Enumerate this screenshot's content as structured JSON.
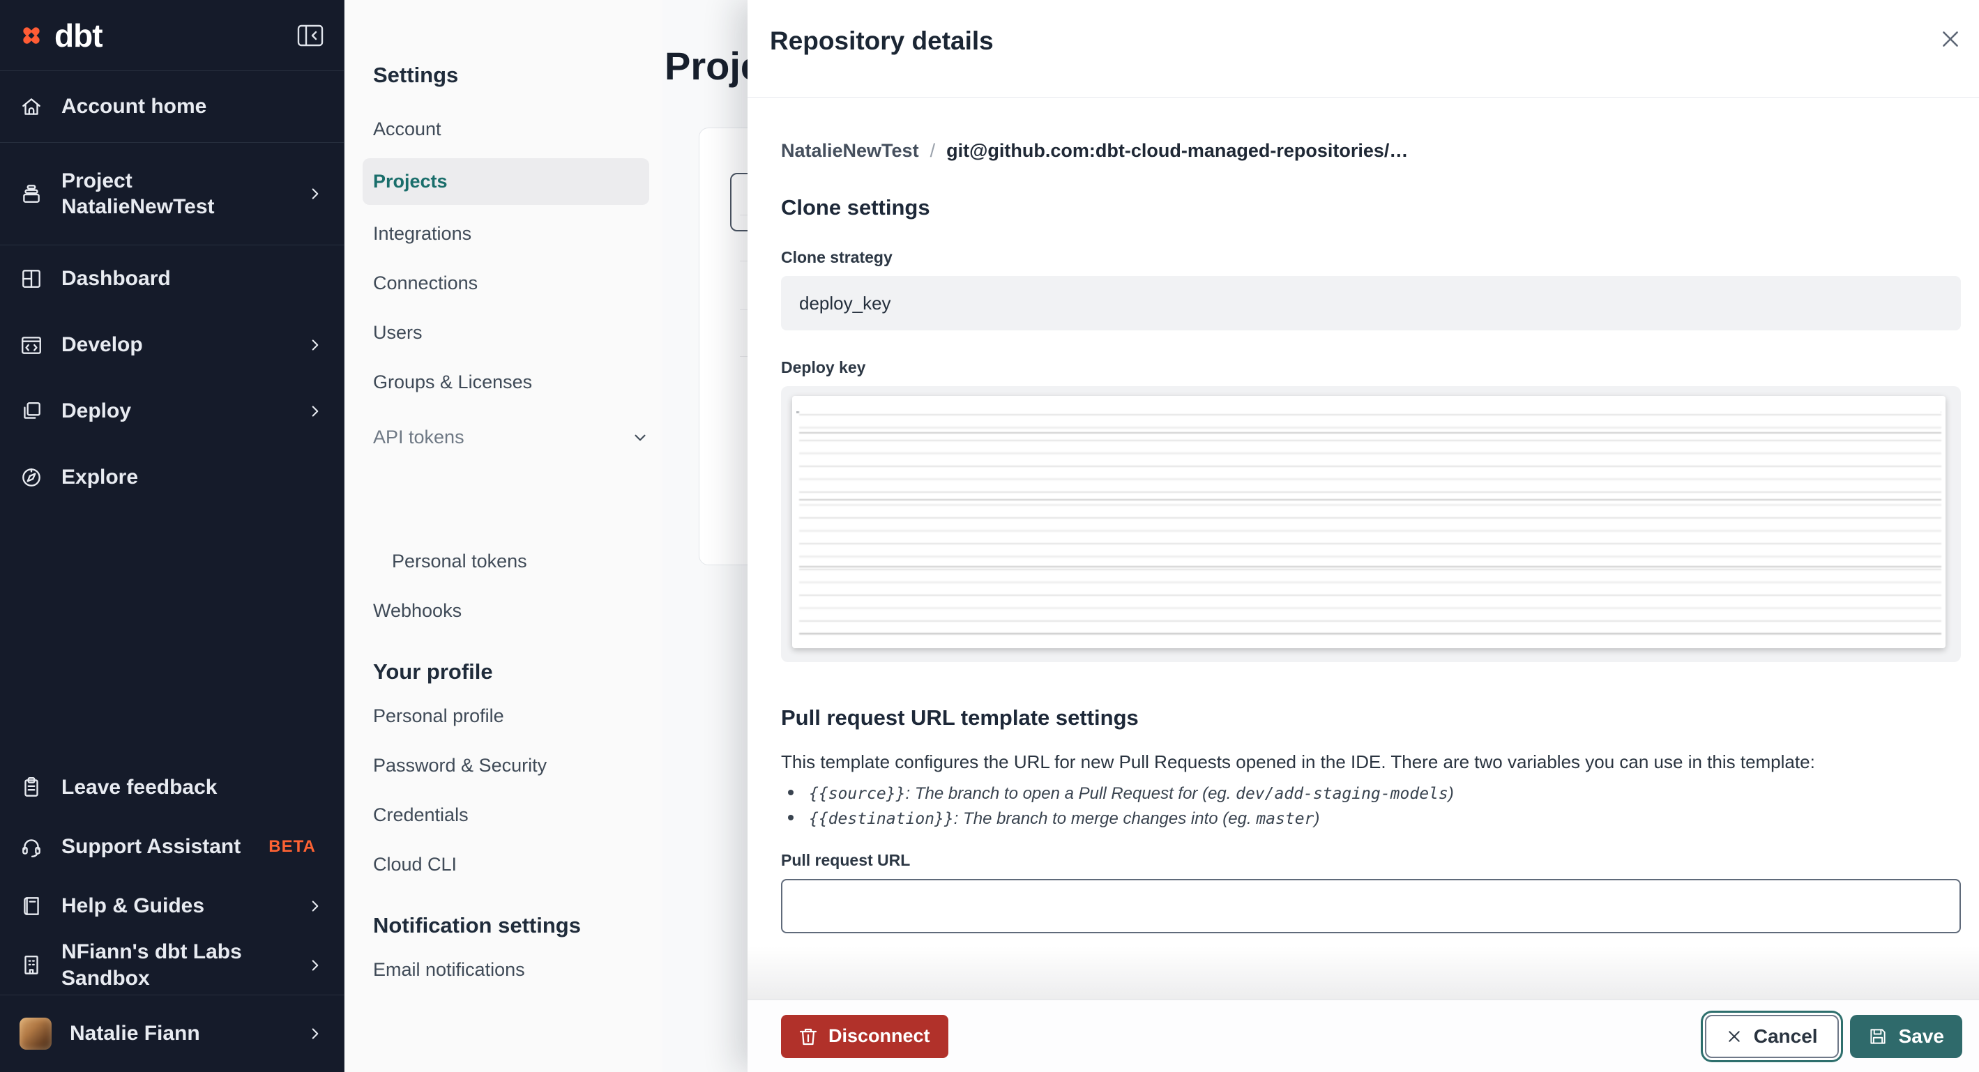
{
  "sidebar": {
    "logo_text": "dbt",
    "account_home": "Account home",
    "project_label": "Project",
    "project_name": "NatalieNewTest",
    "dashboard": "Dashboard",
    "develop": "Develop",
    "deploy": "Deploy",
    "explore": "Explore",
    "leave_feedback": "Leave feedback",
    "support_assistant": "Support Assistant",
    "beta_badge": "BETA",
    "help_guides": "Help & Guides",
    "sandbox": "NFiann's dbt Labs Sandbox",
    "user_name": "Natalie Fiann"
  },
  "settings_nav": {
    "title": "Settings",
    "items": [
      "Account",
      "Projects",
      "Integrations",
      "Connections",
      "Users",
      "Groups & Licenses"
    ],
    "api_tokens": "API tokens",
    "personal_tokens": "Personal tokens",
    "webhooks": "Webhooks",
    "your_profile_heading": "Your profile",
    "profile_items": [
      "Personal profile",
      "Password & Security",
      "Credentials",
      "Cloud CLI"
    ],
    "notification_heading": "Notification settings",
    "email_notifications": "Email notifications"
  },
  "main": {
    "title": "Projects"
  },
  "modal": {
    "title": "Repository details",
    "breadcrumb": {
      "project": "NatalieNewTest",
      "separator": "/",
      "repo": "git@github.com:dbt-cloud-managed-repositories/…"
    },
    "clone_settings_title": "Clone settings",
    "clone_strategy_label": "Clone strategy",
    "clone_strategy_value": "deploy_key",
    "deploy_key_label": "Deploy key",
    "pr_section_title": "Pull request URL template settings",
    "pr_description": "This template configures the URL for new Pull Requests opened in the IDE. There are two variables you can use in this template:",
    "bullets": [
      {
        "code": "{{source}}",
        "text": ": The branch to open a Pull Request for (eg. ",
        "example": "dev/add-staging-models",
        "close": ")"
      },
      {
        "code": "{{destination}}",
        "text": ": The branch to merge changes into (eg. ",
        "example": "master",
        "close": ")"
      }
    ],
    "pr_url_label": "Pull request URL",
    "pr_url_value": "",
    "footer": {
      "disconnect": "Disconnect",
      "cancel": "Cancel",
      "save": "Save"
    }
  },
  "colors": {
    "brand_orange": "#ff5c35",
    "beta_orange": "#fd6233",
    "accent_teal": "#2f6a6b",
    "danger_red": "#b1312a",
    "sidebar_bg": "#151b2a"
  }
}
